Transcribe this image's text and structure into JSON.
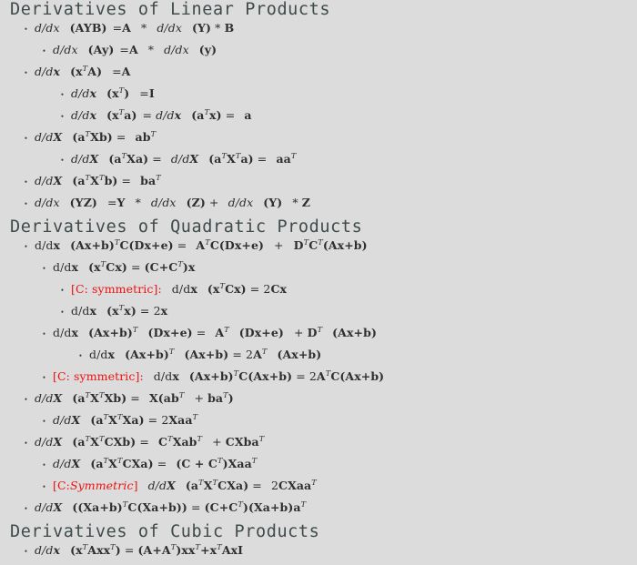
{
  "page": {
    "background_color": "#dcdcdc",
    "text_color": "#2f2f2f",
    "heading_color": "#3f4a4a",
    "accent_color": "#ee1111",
    "bullet_glyph": "•"
  },
  "sections": [
    {
      "heading": "Derivatives of Linear Products",
      "items": [
        {
          "level": 1,
          "text": "d/dx  (AYB)  =A  *  d/dx  (Y) * B"
        },
        {
          "level": 2,
          "text": "d/dx  (Ay)  =A  *  d/dx  (y)"
        },
        {
          "level": 1,
          "text": "d/dx  (xTA)  =A"
        },
        {
          "level": 2,
          "text": "d/dx  (xT)  =I"
        },
        {
          "level": 2,
          "text": "d/dx  (xTa)  = d/dx  (aTx) =  a"
        },
        {
          "level": 1,
          "text": "d/dX  (aTXb) =  abT"
        },
        {
          "level": 2,
          "text": "d/dX  (aTXa) =  d/dX  (aTXTa) =  aaT"
        },
        {
          "level": 1,
          "text": "d/dX  (aTXTb) =  baT"
        },
        {
          "level": 1,
          "text": "d/dx  (YZ)  =Y  *  d/dx  (Z) +  d/dx  (Y)  * Z"
        }
      ]
    },
    {
      "heading": "Derivatives of Quadratic Products",
      "items": [
        {
          "level": 1,
          "text": "d/dx  (Ax+b)TC(Dx+e) =  ATC(Dx+e)  +  DTCT(Ax+b)"
        },
        {
          "level": 2,
          "text": "d/dx  (xTCx) = (C+CT)x"
        },
        {
          "level": 3,
          "text": "[C: symmetric]:  d/dx  (xTCx) = 2Cx",
          "tag": "[C: symmetric]:",
          "tag_color": "#ee1111"
        },
        {
          "level": 3,
          "text": "d/dx  (xTx) = 2x"
        },
        {
          "level": 2,
          "text": "d/dx  (Ax+b)T (Dx+e) =  AT  (Dx+e)  + DT  (Ax+b)"
        },
        {
          "level": 3,
          "text": "d/dx  (Ax+b)T (Ax+b) = 2AT  (Ax+b)"
        },
        {
          "level": 2,
          "text": "[C: symmetric]: d/dx  (Ax+b)TC(Ax+b) = 2ATC(Ax+b)",
          "tag": "[C: symmetric]:",
          "tag_color": "#ee1111"
        },
        {
          "level": 1,
          "text": "d/dX  (aTXTXb) =  X(abT  + baT)"
        },
        {
          "level": 2,
          "text": "d/dX  (aTXTXa) = 2XaaT"
        },
        {
          "level": 1,
          "text": "d/dX  (aTXTCXb) =  CTXabT  + CXbaT"
        },
        {
          "level": 2,
          "text": "d/dX  (aTXTCXa) =  (C + CT)XaaT"
        },
        {
          "level": 2,
          "text": "[C: Symmetric]  d/dX  (aTXTCXa) =  2CXaaT",
          "tag": "[C: Symmetric]",
          "tag_color": "#ee1111"
        },
        {
          "level": 1,
          "text": "d/dX  ((Xa+b)TC(Xa+b)) = (C+CT)(Xa+b)aT"
        }
      ]
    },
    {
      "heading": "Derivatives of Cubic Products",
      "items": [
        {
          "level": 1,
          "text": "d/dx  (xTAxxT) = (A+AT)xxT+xTAxI"
        }
      ]
    }
  ]
}
